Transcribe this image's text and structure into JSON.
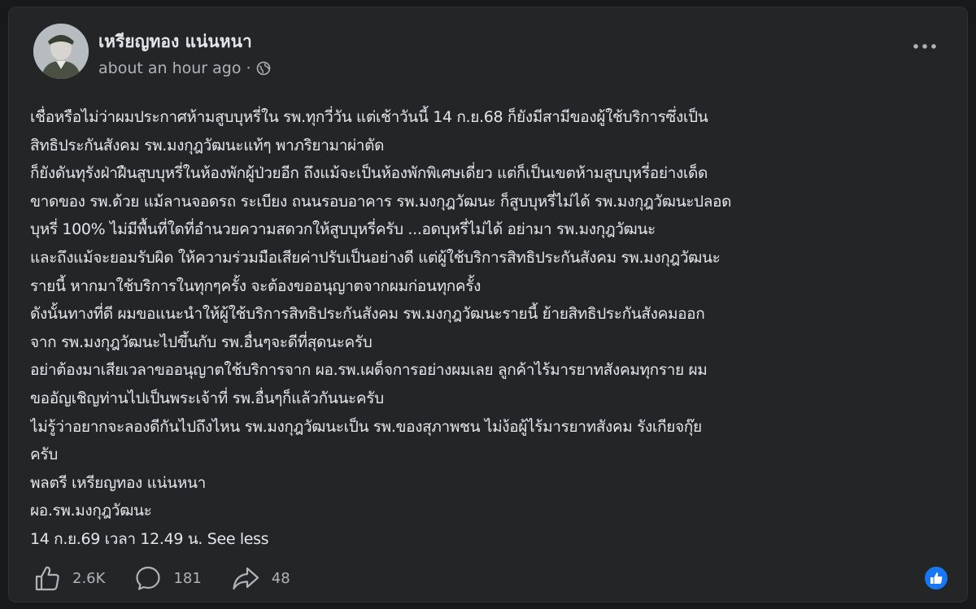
{
  "post": {
    "author": "เหรียญทอง แน่นหนา",
    "timestamp": "about an hour ago",
    "audience_icon": "globe-icon",
    "body_lines": [
      "เชื่อหรือไม่ว่าผมประกาศห้ามสูบบุหรี่ใน รพ.ทุกวี่วัน แต่เช้าวันนี้ 14 ก.ย.68  ก็ยังมีสามีของผู้ใช้บริการซึ่งเป็น",
      "สิทธิประกันสังคม รพ.มงกุฎวัฒนะแท้ๆ พาภริยามาผ่าตัด",
      "ก็ยังดันทุรังฝ่าฝืนสูบบุหรี่ในห้องพักผู้ป่วยอีก ถึงแม้จะเป็นห้องพักพิเศษเดี่ยว แต่ก็เป็นเขตห้ามสูบบุหรี่อย่างเด็ด",
      "ขาดของ รพ.ด้วย แม้ลานจอดรถ ระเบียง ถนนรอบอาคาร รพ.มงกุฎวัฒนะ ก็สูบบุหรี่ไม่ได้ รพ.มงกุฎวัฒนะปลอด",
      "บุหรี่ 100% ไม่มีพื้นที่ใดที่อำนวยความสดวกให้สูบบุหรี่ครับ ...อดบุหรี่ไม่ได้ อย่ามา รพ.มงกุฎวัฒนะ",
      "และถึงแม้จะยอมรับผิด ให้ความร่วมมือเสียค่าปรับเป็นอย่างดี แต่ผู้ใช้บริการสิทธิประกันสังคม รพ.มงกุฎวัฒนะ",
      "รายนี้ หากมาใช้บริการในทุกๆครั้ง จะต้องขออนุญาตจากผมก่อนทุกครั้ง",
      "ดังนั้นทางที่ดี ผมขอแนะนำให้ผู้ใช้บริการสิทธิประกันสังคม รพ.มงกุฎวัฒนะรายนี้ ย้ายสิทธิประกันสังคมออก",
      "จาก รพ.มงกุฎวัฒนะไปขึ้นกับ รพ.อื่นๆจะดีที่สุดนะครับ",
      "อย่าต้องมาเสียเวลาขออนุญาตใช้บริการจาก ผอ.รพ.เผด็จการอย่างผมเลย ลูกค้าไร้มารยาทสังคมทุกราย ผม",
      "ขออัญเชิญท่านไปเป็นพระเจ้าที่ รพ.อื่นๆก็แล้วกันนะครับ",
      "ไม่รู้ว่าอยากจะลองดีกันไปถึงไหน รพ.มงกุฎวัฒนะเป็น รพ.ของสุภาพชน ไม่ง้อผู้ไร้มารยาทสังคม รังเกียจกุ๊ย",
      "ครับ",
      "พลตรี เหรียญทอง แน่นหนา",
      "ผอ.รพ.มงกุฎวัฒนะ"
    ],
    "last_line": "14 ก.ย.69 เวลา 12.49 น.",
    "see_less": "See less"
  },
  "actions": {
    "like_count": "2.6K",
    "comment_count": "181",
    "share_count": "48"
  },
  "colors": {
    "card_bg": "#242526",
    "text": "#e4e6eb",
    "secondary_text": "#b0b3b8",
    "like_blue": "#1877f2"
  }
}
